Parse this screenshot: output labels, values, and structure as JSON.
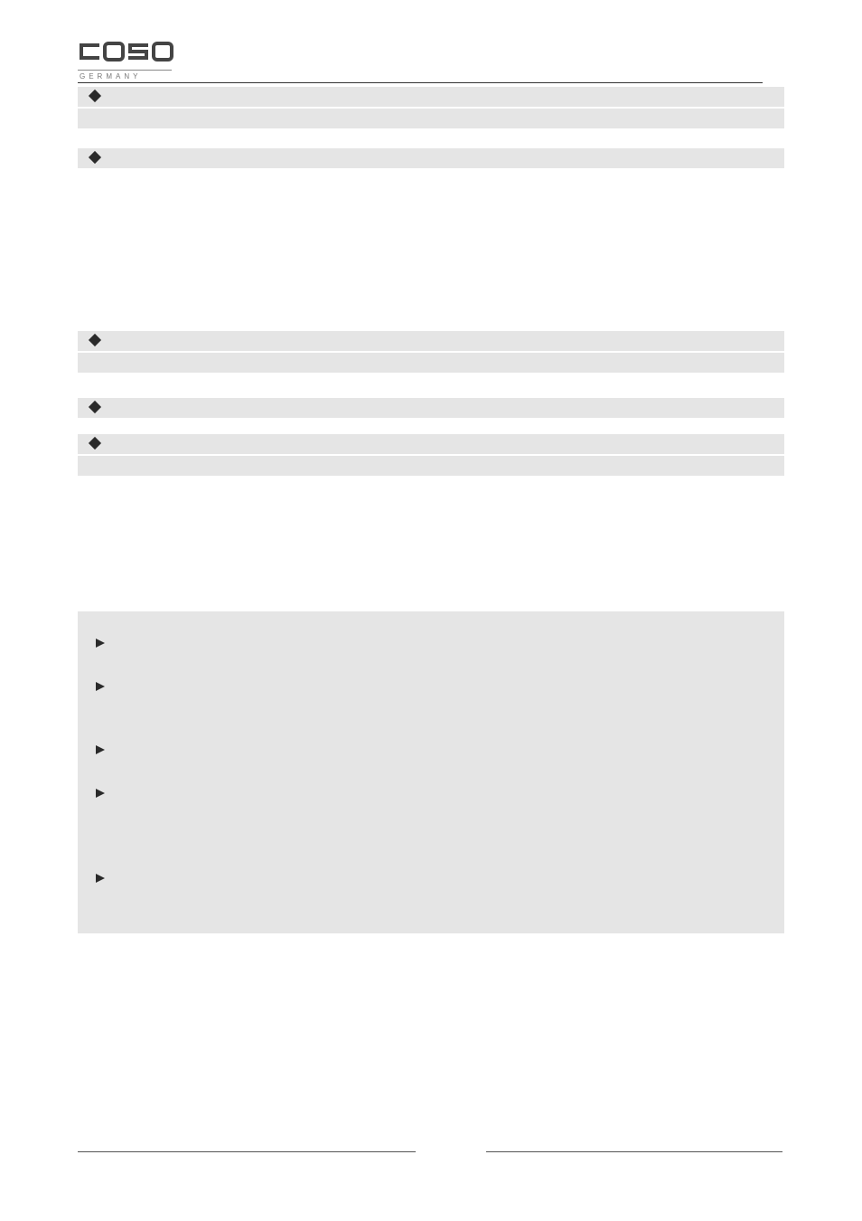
{
  "header": {
    "brand_main": "caso",
    "brand_sub": "GERMANY"
  },
  "content": {
    "items": []
  }
}
